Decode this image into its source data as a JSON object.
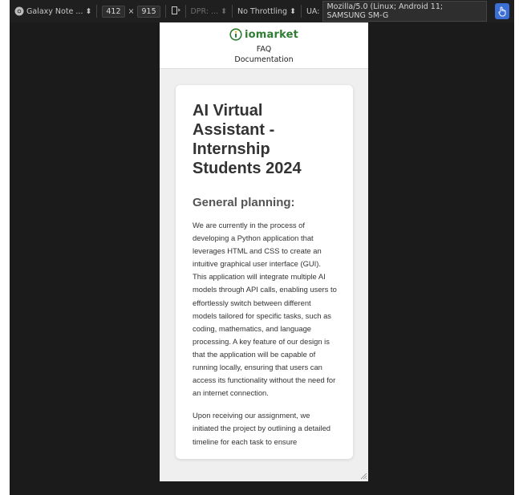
{
  "devtools": {
    "device": "Galaxy Note ...",
    "width": "412",
    "times": "×",
    "height": "915",
    "dpr": "DPR: ...",
    "throttling": "No Throttling",
    "ua_label": "UA:",
    "ua_value": "Mozilla/5.0 (Linux; Android 11; SAMSUNG SM-G",
    "caret": "⬍"
  },
  "site": {
    "logo_text": "iomarket",
    "nav": [
      "FAQ",
      "Documentation"
    ],
    "brand_color": "#2e7d32"
  },
  "article": {
    "title": "AI Virtual Assistant - Internship Students 2024",
    "subtitle": "General planning:",
    "paragraphs": [
      "We are currently in the process of developing a Python application that leverages HTML and CSS to create an intuitive graphical user interface (GUI). This application will integrate multiple AI models through API calls, enabling users to effortlessly switch between different models tailored for specific tasks, such as coding, mathematics, and language processing. A key feature of our design is that the application will be capable of running locally, ensuring that users can access its functionality without the need for an internet connection.",
      "Upon receiving our assignment, we initiated the project by outlining a detailed timeline for each task to ensure"
    ]
  }
}
